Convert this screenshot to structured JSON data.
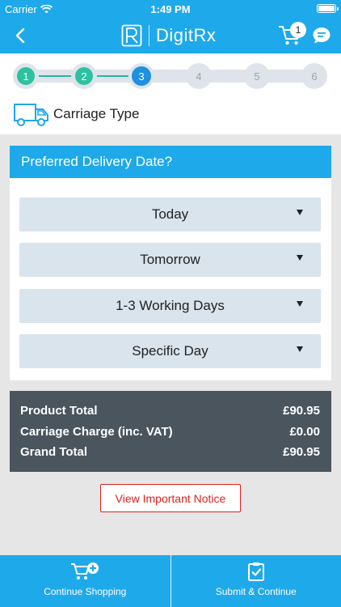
{
  "status_bar": {
    "carrier": "Carrier",
    "time": "1:49 PM"
  },
  "header": {
    "brand": "DigitRx",
    "cart_count": "1"
  },
  "stepper": {
    "steps": [
      {
        "label": "1",
        "state": "done"
      },
      {
        "label": "2",
        "state": "done"
      },
      {
        "label": "3",
        "state": "active"
      },
      {
        "label": "4",
        "state": "pending"
      },
      {
        "label": "5",
        "state": "pending"
      },
      {
        "label": "6",
        "state": "pending"
      }
    ],
    "current_step": 3
  },
  "section": {
    "title": "Carriage Type"
  },
  "delivery": {
    "heading": "Preferred Delivery Date?",
    "options": [
      "Today",
      "Tomorrow",
      "1-3 Working Days",
      "Specific Day"
    ]
  },
  "totals": {
    "product_total_label": "Product Total",
    "product_total_value": "£90.95",
    "carriage_label": "Carriage Charge (inc. VAT)",
    "carriage_value": "£0.00",
    "grand_total_label": "Grand Total",
    "grand_total_value": "£90.95"
  },
  "notice_button": "View Important Notice",
  "tabbar": {
    "continue_shopping": "Continue Shopping",
    "submit_continue": "Submit & Continue"
  },
  "colors": {
    "brand_blue": "#1ea9ea",
    "step_done": "#2cc2a0",
    "step_active": "#1f8fe0",
    "totals_bg": "#4a555e",
    "notice_red": "#d9221f"
  }
}
